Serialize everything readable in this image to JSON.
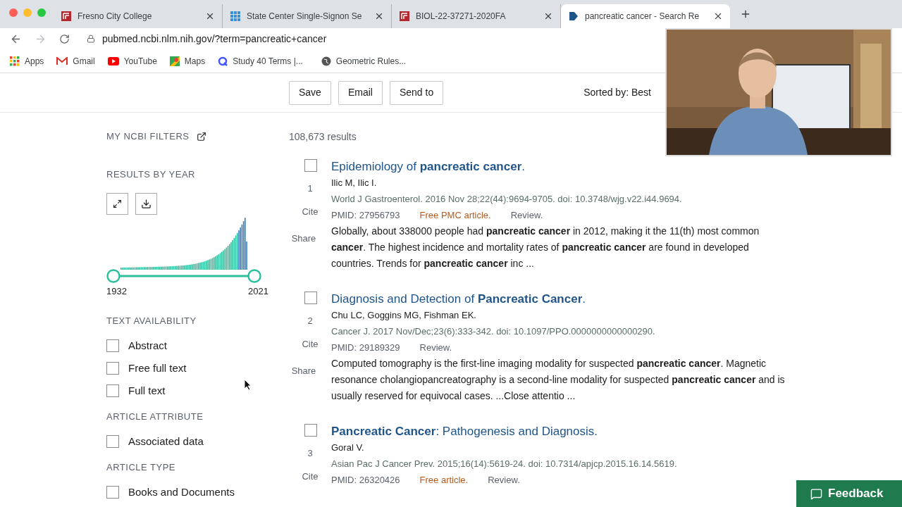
{
  "browser": {
    "tabs": [
      {
        "title": "Fresno City College",
        "selected": false
      },
      {
        "title": "State Center Single-Signon Se",
        "selected": false
      },
      {
        "title": "BIOL-22-37271-2020FA",
        "selected": false
      },
      {
        "title": "pancreatic cancer - Search Re",
        "selected": true
      }
    ],
    "url": "pubmed.ncbi.nlm.nih.gov/?term=pancreatic+cancer",
    "bookmarks": [
      "Apps",
      "Gmail",
      "YouTube",
      "Maps",
      "Study 40 Terms |...",
      "Geometric Rules..."
    ]
  },
  "toolbar": {
    "buttons": [
      "Save",
      "Email",
      "Send to"
    ],
    "sort_label": "Sorted by: Best"
  },
  "sidebar": {
    "my_filters": "MY NCBI FILTERS",
    "results_by_year": "RESULTS BY YEAR",
    "year_start": "1932",
    "year_end": "2021",
    "range_handles": [
      {
        "level": 0
      },
      {
        "level": 1
      }
    ],
    "sections": [
      {
        "heading": "TEXT AVAILABILITY",
        "filters": [
          {
            "label": "Abstract",
            "checked": false
          },
          {
            "label": "Free full text",
            "checked": false
          },
          {
            "label": "Full text",
            "checked": false
          }
        ]
      },
      {
        "heading": "ARTICLE ATTRIBUTE",
        "filters": [
          {
            "label": "Associated data",
            "checked": false
          }
        ]
      },
      {
        "heading": "ARTICLE TYPE",
        "filters": [
          {
            "label": "Books and Documents",
            "checked": false
          }
        ]
      }
    ]
  },
  "results_count": "108,673 results",
  "results": [
    {
      "number": "1",
      "checked": false,
      "title": "Epidemiology of **pancreatic cancer**.",
      "authors": "Ilic M, Ilic I.",
      "citation": "World J Gastroenterol. 2016 Nov 28;22(44):9694-9705. doi: 10.3748/wjg.v22.i44.9694.",
      "pmid": "PMID: 27956793",
      "free": "Free PMC article.",
      "type": "Review.",
      "snippet": "Globally, about 338000 people had **pancreatic cancer** in 2012, making it the 11(th) most common **cancer**. The highest incidence and mortality rates of **pancreatic cancer** are found in developed countries. Trends for **pancreatic cancer** inc ...",
      "actions": [
        "Cite",
        "Share"
      ]
    },
    {
      "number": "2",
      "checked": false,
      "title": "Diagnosis and Detection of **Pancreatic Cancer**.",
      "authors": "Chu LC, Goggins MG, Fishman EK.",
      "citation": "Cancer J. 2017 Nov/Dec;23(6):333-342. doi: 10.1097/PPO.0000000000000290.",
      "pmid": "PMID: 29189329",
      "type": "Review.",
      "snippet": "Computed tomography is the first-line imaging modality for suspected **pancreatic cancer**. Magnetic resonance cholangiopancreatography is a second-line modality for suspected **pancreatic cancer** and is usually reserved for equivocal cases. ...Close attentio ...",
      "actions": [
        "Cite",
        "Share"
      ]
    },
    {
      "number": "3",
      "checked": false,
      "title": "**Pancreatic Cancer**: Pathogenesis and Diagnosis.",
      "authors": "Goral V.",
      "citation": "Asian Pac J Cancer Prev. 2015;16(14):5619-24. doi: 10.7314/apjcp.2015.16.14.5619.",
      "pmid": "PMID: 26320426",
      "free": "Free article.",
      "type": "Review.",
      "actions": [
        "Cite"
      ]
    }
  ],
  "feedback": "Feedback"
}
